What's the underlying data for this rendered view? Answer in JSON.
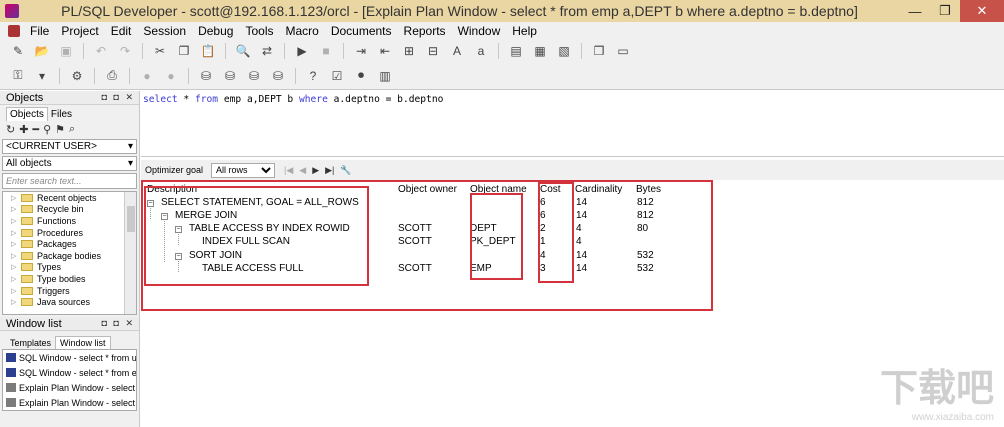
{
  "window": {
    "title": "PL/SQL Developer - scott@192.168.1.123/orcl - [Explain Plan Window - select * from emp a,DEPT b where a.deptno = b.deptno]",
    "controls": [
      "—",
      "❐",
      "✕"
    ]
  },
  "menu": [
    "File",
    "Project",
    "Edit",
    "Session",
    "Debug",
    "Tools",
    "Macro",
    "Documents",
    "Reports",
    "Window",
    "Help"
  ],
  "left_panel": {
    "objects_header": "Objects",
    "panel_controls": "◘ ◘ ✕",
    "tabs": [
      "Objects",
      "Files"
    ],
    "user_combo": "<CURRENT USER>",
    "filter_combo": "All objects",
    "search_placeholder": "Enter search text...",
    "tree_items": [
      "Recent objects",
      "Recycle bin",
      "Functions",
      "Procedures",
      "Packages",
      "Package bodies",
      "Types",
      "Type bodies",
      "Triggers",
      "Java sources"
    ],
    "window_list_header": "Window list",
    "window_list_tabs": [
      "Templates",
      "Window list"
    ],
    "window_list": [
      {
        "label": "SQL Window - select * from user_t",
        "color": "#2c3f8f"
      },
      {
        "label": "SQL Window - select * from emp;",
        "color": "#2c3f8f"
      },
      {
        "label": "Explain Plan Window - select * fron",
        "color": "#7b7b7b"
      },
      {
        "label": "Explain Plan Window - select * fron",
        "color": "#7b7b7b"
      }
    ]
  },
  "editor": {
    "tokens": [
      {
        "t": "select",
        "kw": true
      },
      {
        "t": " * ",
        "kw": false
      },
      {
        "t": "from",
        "kw": true
      },
      {
        "t": " emp a,DEPT b ",
        "kw": false
      },
      {
        "t": "where",
        "kw": true
      },
      {
        "t": " a.deptno = b.deptno",
        "kw": false
      }
    ]
  },
  "optimizer": {
    "label": "Optimizer goal",
    "value": "All rows",
    "nav": [
      "|◀",
      "◀",
      "▶",
      "▶|"
    ],
    "wrench_icon": "🔧"
  },
  "plan": {
    "columns": {
      "description": "Description",
      "owner": "Object owner",
      "name": "Object name",
      "cost": "Cost",
      "cardinality": "Cardinality",
      "bytes": "Bytes"
    },
    "rows": [
      {
        "desc": "SELECT STATEMENT, GOAL = ALL_ROWS",
        "level": 0,
        "owner": "",
        "name": "",
        "cost": "6",
        "card": "14",
        "bytes": "812"
      },
      {
        "desc": "MERGE JOIN",
        "level": 1,
        "owner": "",
        "name": "",
        "cost": "6",
        "card": "14",
        "bytes": "812"
      },
      {
        "desc": "TABLE ACCESS BY INDEX ROWID",
        "level": 2,
        "owner": "SCOTT",
        "name": "DEPT",
        "cost": "2",
        "card": "4",
        "bytes": "80"
      },
      {
        "desc": "INDEX FULL SCAN",
        "level": 3,
        "owner": "SCOTT",
        "name": "PK_DEPT",
        "cost": "1",
        "card": "4",
        "bytes": ""
      },
      {
        "desc": "SORT JOIN",
        "level": 2,
        "owner": "",
        "name": "",
        "cost": "4",
        "card": "14",
        "bytes": "532"
      },
      {
        "desc": "TABLE ACCESS FULL",
        "level": 3,
        "owner": "SCOTT",
        "name": "EMP",
        "cost": "3",
        "card": "14",
        "bytes": "532"
      }
    ]
  },
  "watermark": {
    "main": "下载吧",
    "sub": "www.xiazaiba.com"
  },
  "colors": {
    "titlebar": "#e9d6a3",
    "highlight": "#d4333d",
    "keyword": "#3b3bd4"
  }
}
